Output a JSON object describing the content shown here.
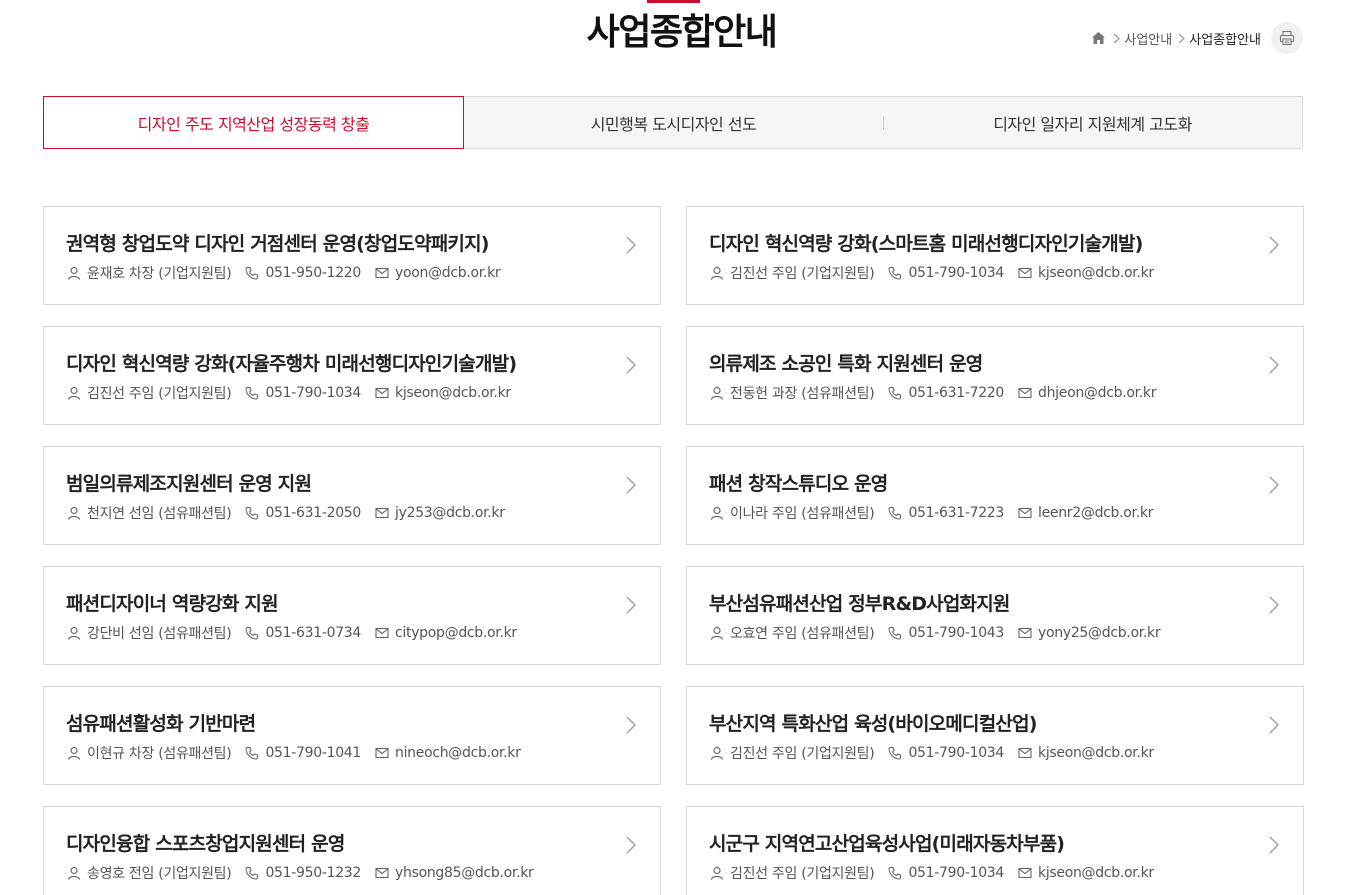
{
  "page": {
    "title": "사업종합안내"
  },
  "breadcrumb": {
    "items": [
      "사업안내",
      "사업종합안내"
    ]
  },
  "tabs": [
    {
      "label": "디자인 주도 지역산업 성장동력 창출",
      "active": true
    },
    {
      "label": "시민행복 도시디자인 선도",
      "active": false
    },
    {
      "label": "디자인 일자리 지원체계 고도화",
      "active": false
    }
  ],
  "colors": {
    "accent": "#c8102e"
  },
  "cards": [
    {
      "title": "권역형 창업도약 디자인 거점센터 운영(창업도약패키지)",
      "person": "윤재호 차장 (기업지원팀)",
      "phone": "051-950-1220",
      "email": "yoon@dcb.or.kr"
    },
    {
      "title": "디자인 혁신역량 강화(스마트홈 미래선행디자인기술개발)",
      "person": "김진선 주임 (기업지원팀)",
      "phone": "051-790-1034",
      "email": "kjseon@dcb.or.kr"
    },
    {
      "title": "디자인 혁신역량 강화(자율주행차 미래선행디자인기술개발)",
      "person": "김진선 주임 (기업지원팀)",
      "phone": "051-790-1034",
      "email": "kjseon@dcb.or.kr"
    },
    {
      "title": "의류제조 소공인 특화 지원센터 운영",
      "person": "전동헌 과장 (섬유패션팀)",
      "phone": "051-631-7220",
      "email": "dhjeon@dcb.or.kr"
    },
    {
      "title": "범일의류제조지원센터 운영 지원",
      "person": "천지연 선임 (섬유패션팀)",
      "phone": "051-631-2050",
      "email": "jy253@dcb.or.kr"
    },
    {
      "title": "패션 창작스튜디오 운영",
      "person": "이나라 주임 (섬유패션팀)",
      "phone": "051-631-7223",
      "email": "leenr2@dcb.or.kr"
    },
    {
      "title": "패션디자이너 역량강화 지원",
      "person": "강단비 선임 (섬유패션팀)",
      "phone": "051-631-0734",
      "email": "citypop@dcb.or.kr"
    },
    {
      "title": "부산섬유패션산업 정부R&D사업화지원",
      "person": "오효연 주임 (섬유패션팀)",
      "phone": "051-790-1043",
      "email": "yony25@dcb.or.kr"
    },
    {
      "title": "섬유패션활성화 기반마련",
      "person": "이현규 차장 (섬유패션팀)",
      "phone": "051-790-1041",
      "email": "nineoch@dcb.or.kr"
    },
    {
      "title": "부산지역 특화산업 육성(바이오메디컬산업)",
      "person": "김진선 주임 (기업지원팀)",
      "phone": "051-790-1034",
      "email": "kjseon@dcb.or.kr"
    },
    {
      "title": "디자인융합 스포츠창업지원센터 운영",
      "person": "송영호 전임 (기업지원팀)",
      "phone": "051-950-1232",
      "email": "yhsong85@dcb.or.kr"
    },
    {
      "title": "시군구 지역연고산업육성사업(미래자동차부품)",
      "person": "김진선 주임 (기업지원팀)",
      "phone": "051-790-1034",
      "email": "kjseon@dcb.or.kr"
    }
  ]
}
